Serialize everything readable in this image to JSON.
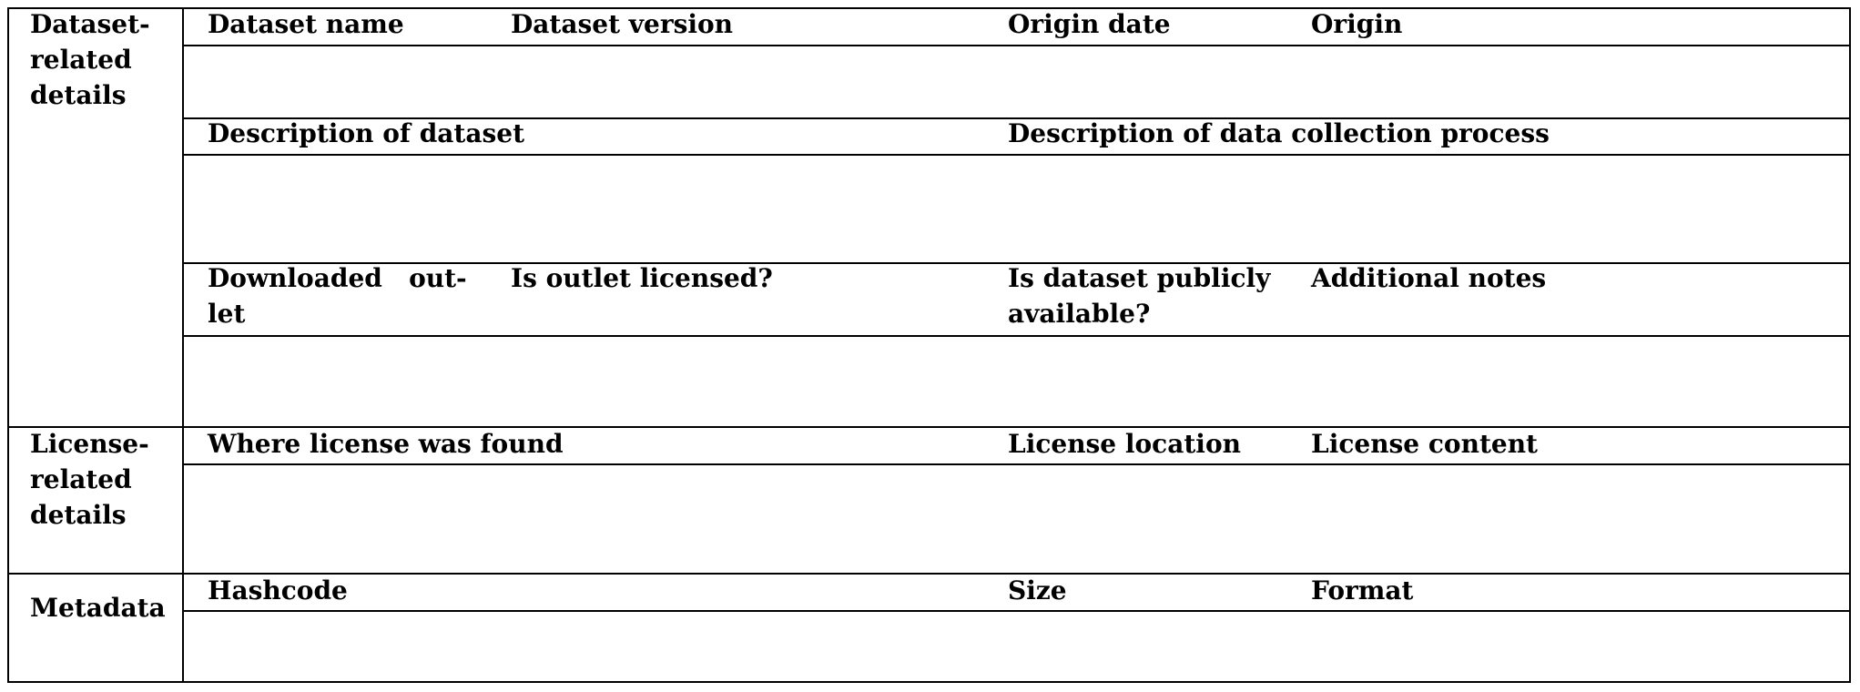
{
  "sections": {
    "dataset": {
      "line1": "Dataset-",
      "line2": "related",
      "line3": "details"
    },
    "license": {
      "line1": "License-",
      "line2": "related",
      "line3": "details"
    },
    "metadata": {
      "label": "Metadata"
    }
  },
  "dataset_fields": {
    "row1": {
      "name": "Dataset name",
      "version": "Dataset version",
      "origin_date": "Origin date",
      "origin": "Origin"
    },
    "row2": {
      "description": "Description of dataset",
      "collection_process": "Description of data collection process"
    },
    "row3": {
      "downloaded_outlet_line1": "Downloaded   out-",
      "downloaded_outlet_line2": "let",
      "outlet_licensed": "Is outlet licensed?",
      "publicly_available_line1": "Is dataset publicly",
      "publicly_available_line2": "available?",
      "additional_notes": "Additional notes"
    }
  },
  "license_fields": {
    "where_found": "Where license was found",
    "location": "License location",
    "content": "License content"
  },
  "metadata_fields": {
    "hashcode": "Hashcode",
    "size": "Size",
    "format": "Format"
  }
}
